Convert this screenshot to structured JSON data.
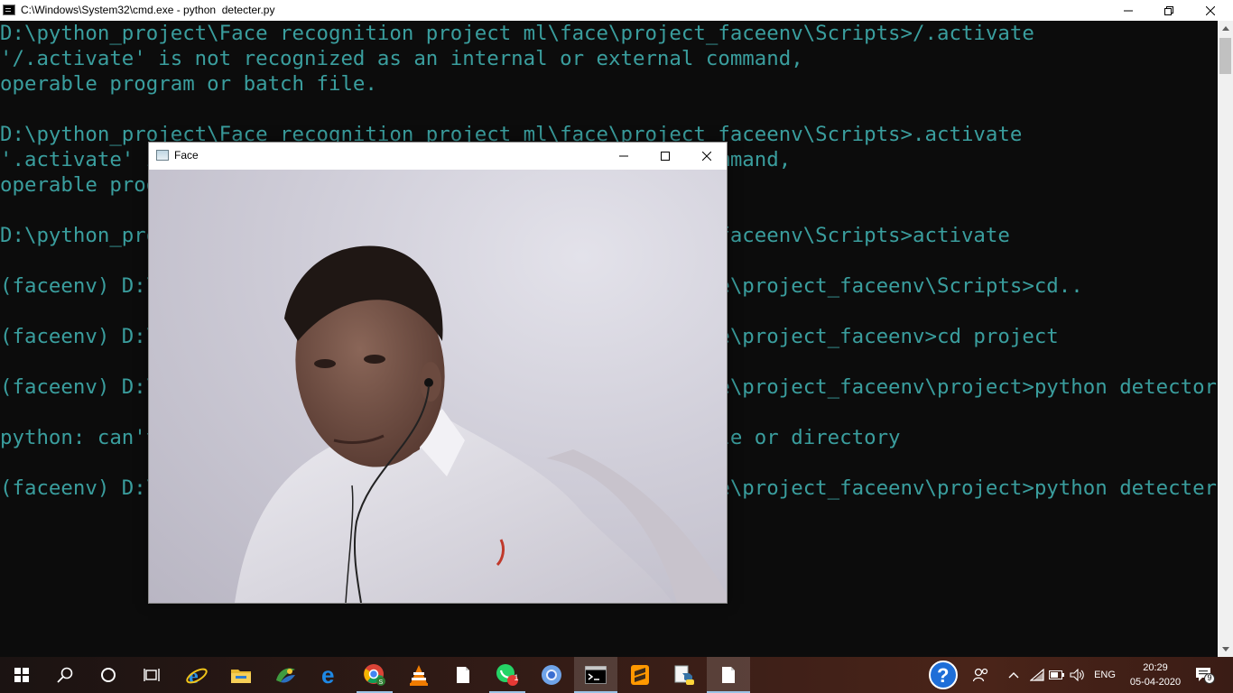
{
  "cmd_window": {
    "title": "C:\\Windows\\System32\\cmd.exe - python  detecter.py",
    "lines": [
      "D:\\python_project\\Face recognition project ml\\face\\project_faceenv\\Scripts>/.activate",
      "'/.activate' is not recognized as an internal or external command,",
      "operable program or batch file.",
      "",
      "D:\\python_project\\Face recognition project ml\\face\\project_faceenv\\Scripts>.activate",
      "'.activate' is not recognized as an internal or external command,",
      "operable program or batch file.",
      "",
      "D:\\python_project\\Face recognition project ml\\face\\project_faceenv\\Scripts>activate",
      "",
      "(faceenv) D:\\python_project\\Face recognition project ml\\face\\project_faceenv\\Scripts>cd..",
      "",
      "(faceenv) D:\\python_project\\Face recognition project ml\\face\\project_faceenv>cd project",
      "",
      "(faceenv) D:\\python_project\\Face recognition project ml\\face\\project_faceenv\\project>python detector.py",
      "",
      "python: can't open file 'detector.py': [Errno 2] No such file or directory",
      "",
      "(faceenv) D:\\python_project\\Face recognition project ml\\face\\project_faceenv\\project>python detecter.py"
    ]
  },
  "face_window": {
    "title": "Face"
  },
  "taskbar": {
    "items": [
      "start",
      "search",
      "cortana",
      "task-view",
      "internet-explorer",
      "file-explorer",
      "gallery",
      "edge",
      "chrome",
      "vlc",
      "file",
      "whatsapp",
      "chromium",
      "command-prompt",
      "sublime-text",
      "python",
      "notepad"
    ],
    "whatsapp_badge": "1",
    "language": "ENG",
    "time": "20:29",
    "date": "05-04-2020",
    "notification_count": "9"
  },
  "colors": {
    "console_text": "#3a9e9e",
    "console_bg": "#0c0c0c"
  }
}
